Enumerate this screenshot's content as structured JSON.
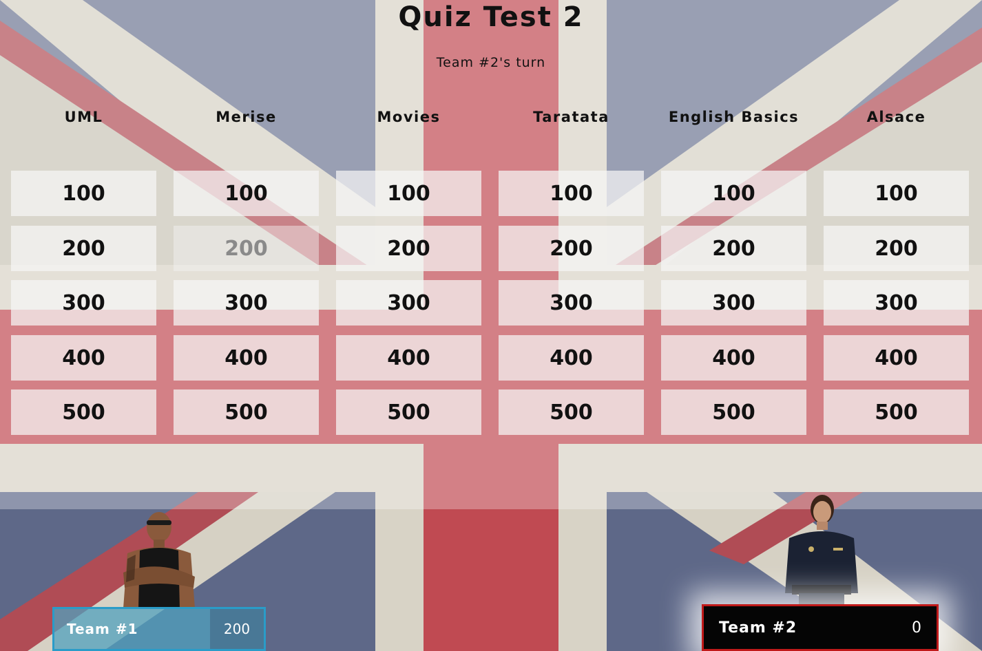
{
  "title": "Quiz Test 2",
  "turn_text": "Team #2's turn",
  "categories": [
    "UML",
    "Merise",
    "Movies",
    "Taratata",
    "English Basics",
    "Alsace"
  ],
  "values": [
    "100",
    "200",
    "300",
    "400",
    "500"
  ],
  "used_cells": [
    {
      "category": 1,
      "row": 1
    }
  ],
  "teams": [
    {
      "name": "Team #1",
      "score": "200",
      "border_color": "#2a9cc8"
    },
    {
      "name": "Team #2",
      "score": "0",
      "border_color": "#c01a1a",
      "active": true
    }
  ],
  "colors": {
    "flag_red": "#c8323c",
    "flag_blue": "#3c4a78",
    "flag_white": "#d8d4c8"
  }
}
